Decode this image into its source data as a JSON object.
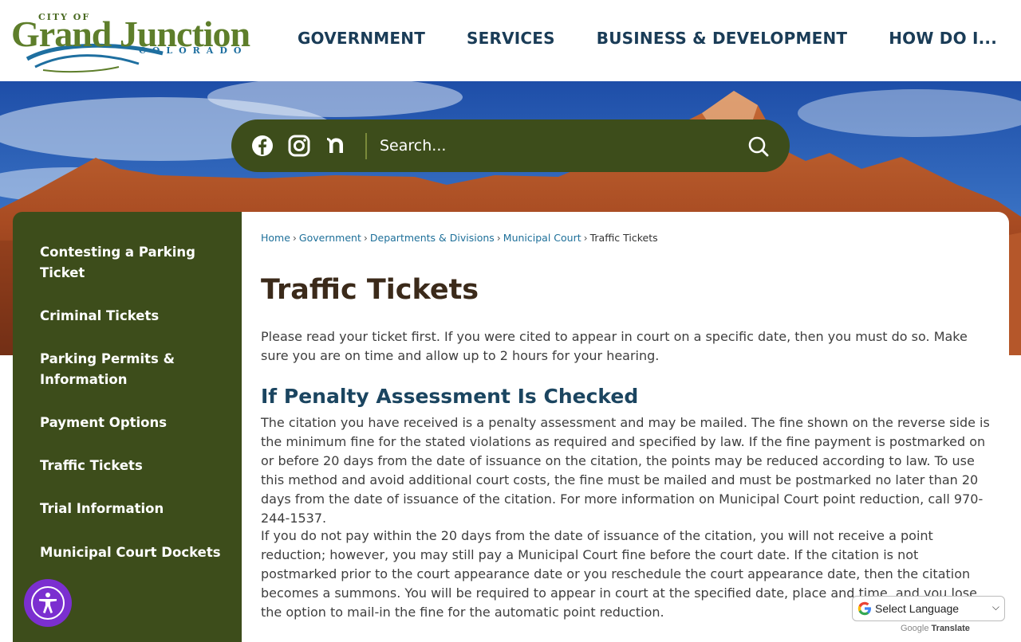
{
  "logo": {
    "city_of": "CITY OF",
    "name": "Grand Junction",
    "state": "COLORADO"
  },
  "nav": {
    "items": [
      "GOVERNMENT",
      "SERVICES",
      "BUSINESS & DEVELOPMENT",
      "HOW DO I..."
    ]
  },
  "search": {
    "placeholder": "Search..."
  },
  "social": [
    "facebook-icon",
    "instagram-icon",
    "nextdoor-icon"
  ],
  "sidebar": {
    "items": [
      {
        "label": "Contesting a Parking Ticket"
      },
      {
        "label": "Criminal Tickets"
      },
      {
        "label": "Parking Permits & Information"
      },
      {
        "label": "Payment Options"
      },
      {
        "label": "Traffic Tickets"
      },
      {
        "label": "Trial Information"
      },
      {
        "label": "Municipal Court Dockets"
      }
    ]
  },
  "breadcrumb": {
    "items": [
      "Home",
      "Government",
      "Departments & Divisions",
      "Municipal Court"
    ],
    "current": "Traffic Tickets",
    "separator": "›"
  },
  "main": {
    "title": "Traffic Tickets",
    "intro": "Please read your ticket first. If you were cited to appear in court on a specific date, then you must do so. Make sure you are on time and allow up to 2 hours for your hearing.",
    "section_heading": "If Penalty Assessment Is Checked",
    "para1": "The citation you have received is a penalty assessment and may be mailed. The fine shown on the reverse side is the minimum fine for the stated violations as required and specified by law. If the fine payment is postmarked on or before 20 days from the date of issuance on the citation, the points may be reduced according to law. To use this method and avoid additional court costs, the fine must be mailed and must be postmarked no later than 20 days from the date of issuance of the citation. For more information on Municipal Court point reduction, call 970-244-1537.",
    "para2": "If you do not pay within the 20 days from the date of issuance of the citation, you will not receive a point reduction; however, you may still pay a Municipal Court fine before the court date. If the citation is not postmarked prior to the court appearance date or you reschedule the court appearance date, then the citation becomes a summons. You will be required to appear in court at the specified date, place and time, and you lose the option to mail-in the fine for the automatic point reduction."
  },
  "translate": {
    "select_label": "Select Language",
    "powered_google": "Google",
    "powered_translate": "Translate"
  },
  "colors": {
    "olive": "#3d4d1b",
    "nav_text": "#1a3c57",
    "link": "#1d6f99",
    "title": "#3b2a1a",
    "heading": "#1b4560",
    "a11y": "#7b2fd0"
  }
}
